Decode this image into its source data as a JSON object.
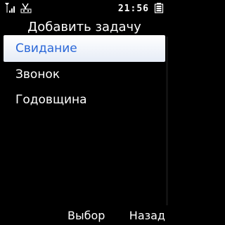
{
  "status": {
    "time": "21:56",
    "icons": [
      "signal-icon",
      "voicemail-icon",
      "battery-icon"
    ]
  },
  "header": {
    "title": "Добавить задачу"
  },
  "menu": {
    "items": [
      {
        "label": "Свидание",
        "selected": true
      },
      {
        "label": "Звонок",
        "selected": false
      },
      {
        "label": "Годовщина",
        "selected": false
      }
    ]
  },
  "softkeys": {
    "left": "Выбор",
    "right": "Назад"
  },
  "colors": {
    "background": "#000000",
    "text": "#ffffff",
    "selected_text": "#2a67d8",
    "selection_bg_top": "#ffffff",
    "selection_bg_bottom": "#e6ecf6"
  }
}
